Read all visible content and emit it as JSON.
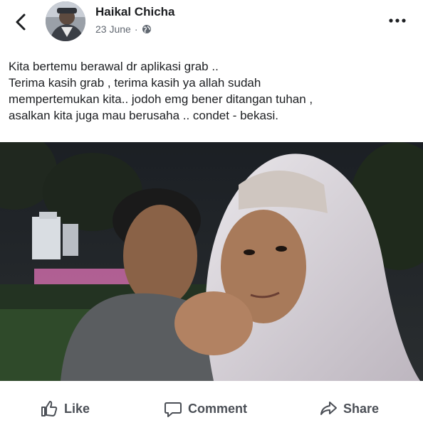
{
  "post": {
    "author": "Haikal Chicha",
    "date": "23 June",
    "separator": "·",
    "privacy_icon": "globe-icon",
    "caption_lines": [
      "Kita bertemu berawal dr aplikasi grab ..",
      "Terima kasih grab , terima kasih ya allah sudah",
      "mempertemukan kita.. jodoh emg bener ditangan tuhan ,",
      "asalkan kita juga mau berusaha .. condet - bekasi."
    ]
  },
  "header": {
    "back_icon": "chevron-left-icon",
    "more_icon": "more-horizontal-icon"
  },
  "actions": {
    "like_label": "Like",
    "comment_label": "Comment",
    "share_label": "Share"
  }
}
